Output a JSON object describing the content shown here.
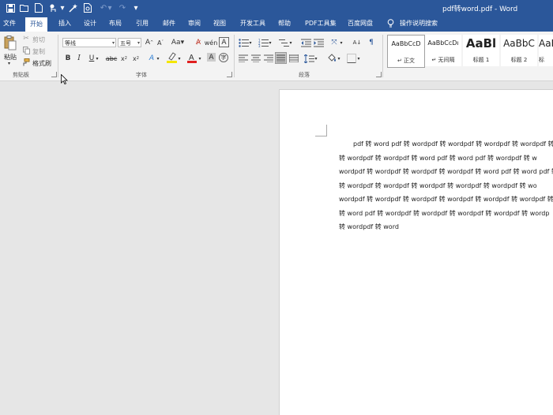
{
  "window": {
    "title": "pdf转word.pdf  -  Word"
  },
  "menu": [
    "文件",
    "开始",
    "插入",
    "设计",
    "布局",
    "引用",
    "邮件",
    "审阅",
    "视图",
    "开发工具",
    "帮助",
    "PDF工具集",
    "百度网盘"
  ],
  "tell_me": "操作说明搜索",
  "ribbon": {
    "clipboard": {
      "paste": "粘贴",
      "cut": "剪切",
      "copy": "复制",
      "format_painter": "格式刷",
      "group": "剪贴板"
    },
    "font": {
      "font_name": "等线",
      "font_size": "五号",
      "group": "字体"
    },
    "paragraph": {
      "group": "段落"
    },
    "styles": [
      {
        "preview": "AaBbCcD",
        "name": "↵ 正文"
      },
      {
        "preview": "AaBbCcDı",
        "name": "↵ 无间隔"
      },
      {
        "preview": "AaBl",
        "name": "标题 1"
      },
      {
        "preview": "AaBbC",
        "name": "标题 2"
      },
      {
        "preview": "AaB",
        "name": "标"
      }
    ]
  },
  "document": {
    "lines": [
      "pdf 转 word pdf 转 wordpdf 转 wordpdf 转 wordpdf 转 wordpdf 转",
      "转 wordpdf 转 wordpdf 转 word pdf 转 word pdf 转 wordpdf 转 w",
      "wordpdf 转 wordpdf 转 wordpdf 转 wordpdf 转 word pdf 转 word pdf 转",
      "转 wordpdf 转 wordpdf 转 wordpdf 转 wordpdf 转 wordpdf 转 wo",
      "wordpdf 转 wordpdf 转 wordpdf 转 wordpdf 转 wordpdf 转 wordpdf 转",
      "转 word pdf 转 wordpdf 转 wordpdf 转 wordpdf 转 wordpdf 转 wordp",
      "转 wordpdf 转 word"
    ]
  }
}
